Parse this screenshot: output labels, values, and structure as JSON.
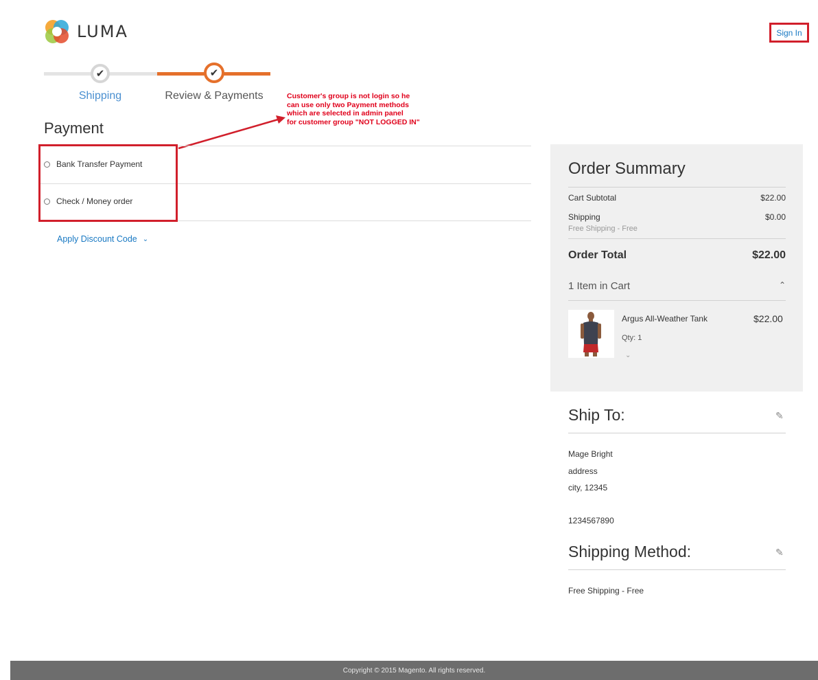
{
  "header": {
    "logo_text": "LUMA",
    "sign_in_label": "Sign In"
  },
  "progress": {
    "steps": [
      {
        "label": "Shipping",
        "icon": "check-icon"
      },
      {
        "label": "Review & Payments",
        "icon": "check-icon"
      }
    ],
    "check_glyph": "✔"
  },
  "annotation": {
    "lines": [
      "Customer's group is not login so he",
      "can use only two Payment methods",
      "which are selected in admin panel",
      "for customer group \"NOT LOGGED IN\""
    ]
  },
  "payment": {
    "title": "Payment",
    "methods": [
      {
        "label": "Bank Transfer Payment"
      },
      {
        "label": "Check / Money order"
      }
    ],
    "discount_label": "Apply Discount Code"
  },
  "order_summary": {
    "title": "Order Summary",
    "cart_subtotal_label": "Cart Subtotal",
    "cart_subtotal_value": "$22.00",
    "shipping_label": "Shipping",
    "shipping_value": "$0.00",
    "shipping_sub": "Free Shipping - Free",
    "order_total_label": "Order Total",
    "order_total_value": "$22.00",
    "items_label": "1 Item in Cart",
    "item": {
      "name": "Argus All-Weather Tank",
      "price": "$22.00",
      "qty": "Qty: 1"
    }
  },
  "ship_to": {
    "title": "Ship To:",
    "lines": [
      "Mage Bright",
      "address",
      "city, 12345",
      "1234567890"
    ]
  },
  "shipping_method": {
    "title": "Shipping Method:",
    "value": "Free Shipping - Free"
  },
  "footer": {
    "copyright": "Copyright © 2015 Magento. All rights reserved."
  },
  "colors": {
    "accent_orange": "#e5702b",
    "link_blue": "#1979c3",
    "annotation_red": "#e0001b",
    "highlight_red": "#d11f2b"
  }
}
